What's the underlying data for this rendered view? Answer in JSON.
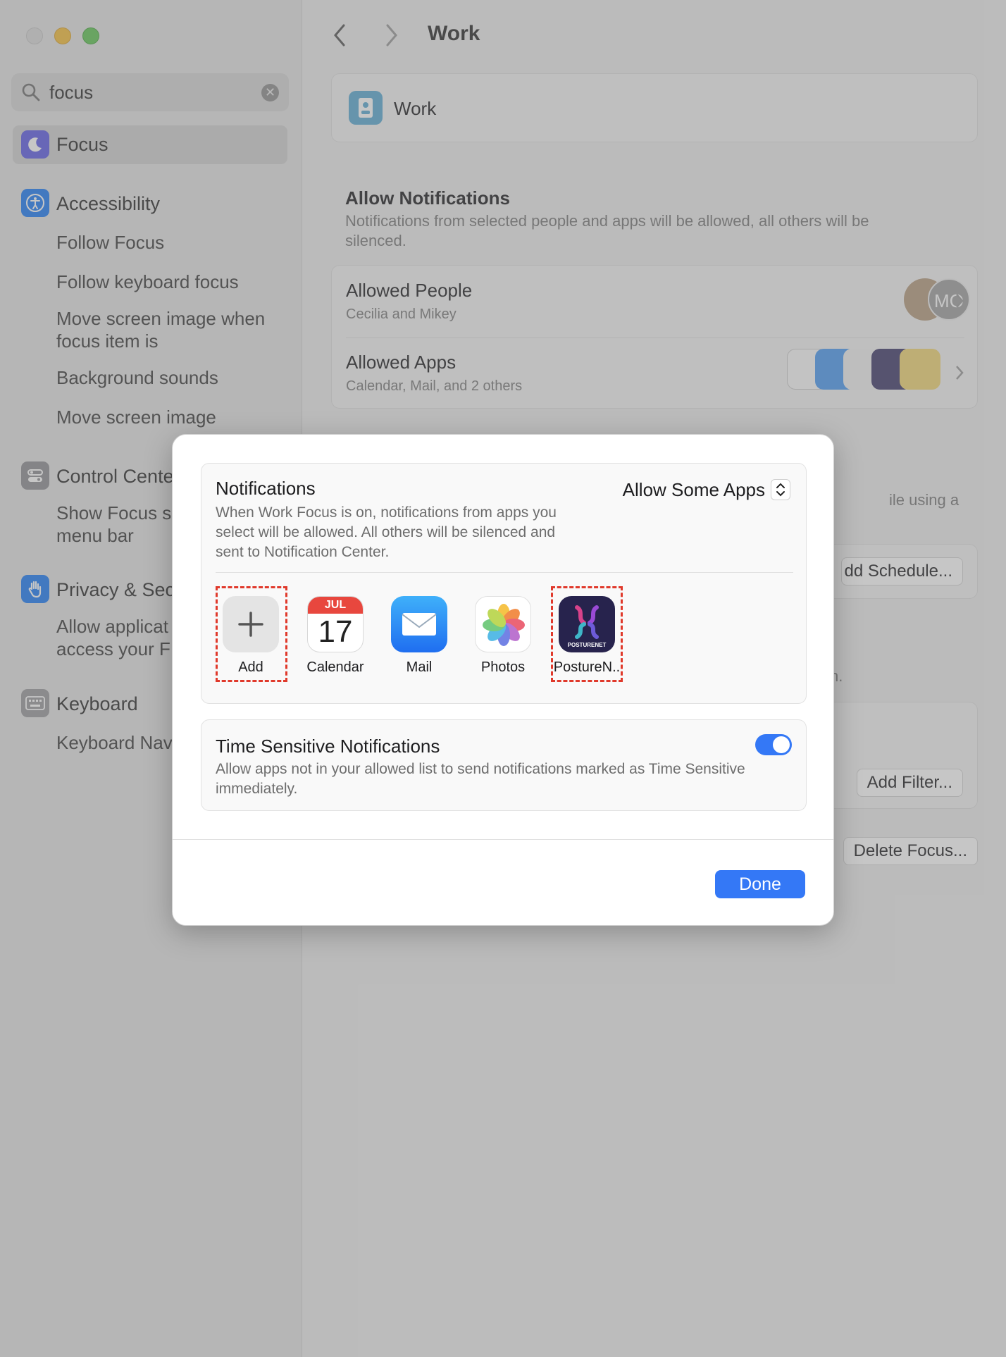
{
  "sidebar": {
    "search": {
      "value": "focus",
      "placeholder": "Search"
    },
    "selected_item": "Focus",
    "sections": [
      {
        "label": "Accessibility",
        "subitems": [
          "Follow Focus",
          "Follow keyboard focus",
          "Move screen image when\nfocus item is",
          "Background sounds",
          "Move screen image"
        ]
      },
      {
        "label": "Control Cente",
        "subitems": [
          "Show Focus s\nmenu bar"
        ]
      },
      {
        "label": "Privacy & Sec",
        "subitems": [
          "Allow applicat\naccess your F"
        ]
      },
      {
        "label": "Keyboard",
        "subitems": [
          "Keyboard Nav"
        ]
      }
    ]
  },
  "main": {
    "title": "Work",
    "focus_name": "Work",
    "allow_notifications": {
      "heading": "Allow Notifications",
      "description": "Notifications from selected people and apps will be allowed, all others will be silenced."
    },
    "allowed_people": {
      "title": "Allowed People",
      "subtitle": "Cecilia and Mikey",
      "avatar_initials": "MO"
    },
    "allowed_apps": {
      "title": "Allowed Apps",
      "subtitle": "Calendar, Mail, and 2 others"
    },
    "partial_text": {
      "using": "ile using a",
      "n": "n."
    },
    "buttons": {
      "add_schedule": "dd Schedule...",
      "add_filter": "Add Filter...",
      "delete_focus": "Delete Focus..."
    }
  },
  "modal": {
    "notifications": {
      "title": "Notifications",
      "description": "When Work Focus is on, notifications from apps you select will be allowed. All others will be silenced and sent to Notification Center.",
      "mode": "Allow Some Apps"
    },
    "apps": [
      {
        "label": "Add",
        "icon": "plus-icon"
      },
      {
        "label": "Calendar",
        "icon": "calendar-icon",
        "month": "JUL",
        "day": "17"
      },
      {
        "label": "Mail",
        "icon": "mail-icon"
      },
      {
        "label": "Photos",
        "icon": "photos-icon"
      },
      {
        "label": "PostureN..",
        "icon": "posturenet-icon",
        "brand": "POSTURENET"
      }
    ],
    "time_sensitive": {
      "title": "Time Sensitive Notifications",
      "description": "Allow apps not in your allowed list to send notifications marked as Time Sensitive immediately.",
      "enabled": true
    },
    "done_label": "Done"
  },
  "colors": {
    "accent": "#3478f6",
    "highlight_dash": "#e0392b"
  }
}
